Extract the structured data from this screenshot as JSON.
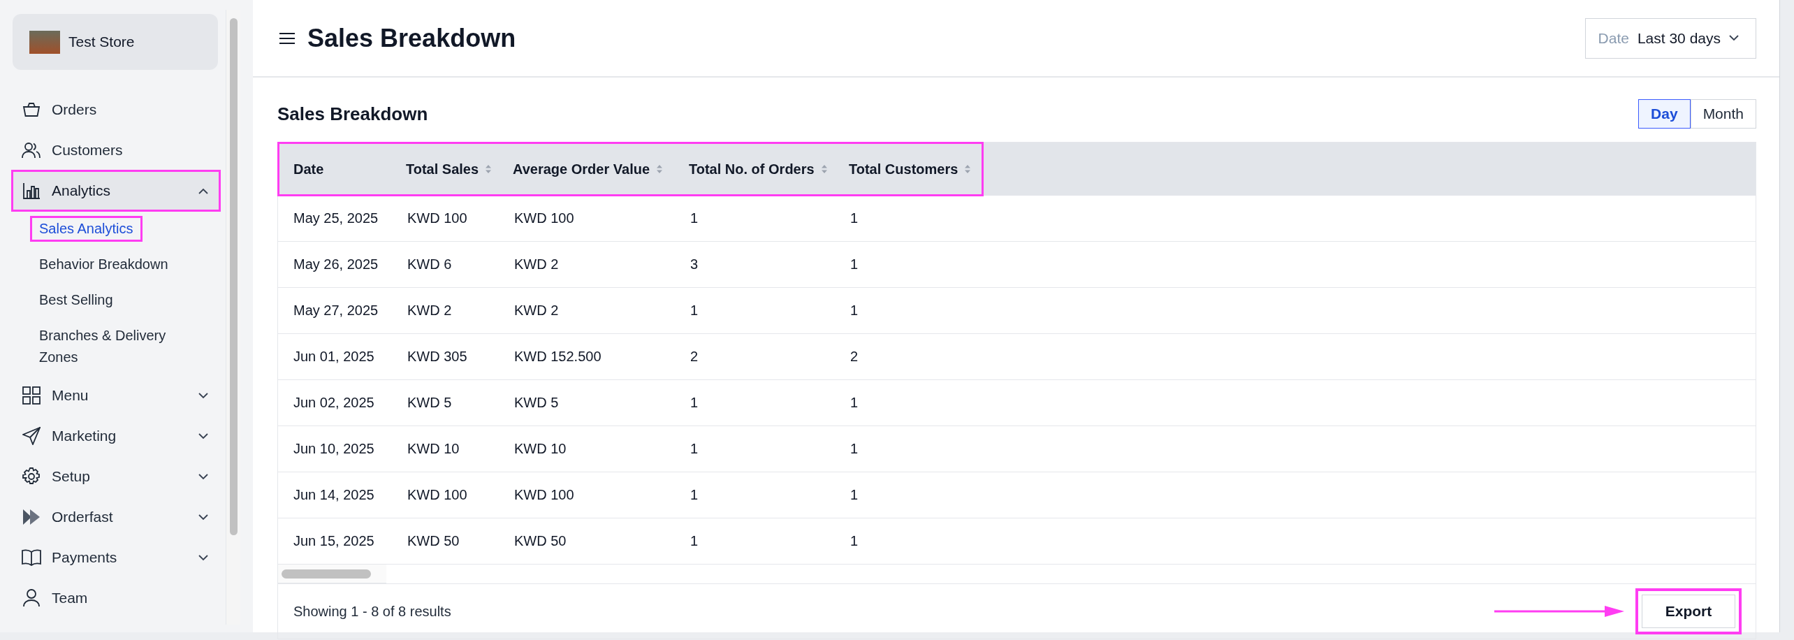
{
  "store": {
    "name": "Test Store"
  },
  "nav": [
    {
      "label": "Orders",
      "kind": "link",
      "selected": false
    },
    {
      "label": "Customers",
      "kind": "link",
      "selected": false
    },
    {
      "label": "Analytics",
      "kind": "group",
      "selected": true,
      "expanded": true,
      "highlighted": true,
      "children": [
        {
          "label": "Sales Analytics",
          "selected": true,
          "highlighted": true
        },
        {
          "label": "Behavior Breakdown",
          "selected": false,
          "highlighted": false
        },
        {
          "label": "Best Selling",
          "selected": false,
          "highlighted": false
        },
        {
          "label": "Branches & Delivery Zones",
          "selected": false,
          "highlighted": false
        }
      ]
    },
    {
      "label": "Menu",
      "kind": "group",
      "selected": false,
      "expanded": false,
      "highlighted": false
    },
    {
      "label": "Marketing",
      "kind": "group",
      "selected": false,
      "expanded": false,
      "highlighted": false
    },
    {
      "label": "Setup",
      "kind": "group",
      "selected": false,
      "expanded": false,
      "highlighted": false
    },
    {
      "label": "Orderfast",
      "kind": "group",
      "selected": false,
      "expanded": false,
      "highlighted": false
    },
    {
      "label": "Payments",
      "kind": "group",
      "selected": false,
      "expanded": false,
      "highlighted": false
    },
    {
      "label": "Team",
      "kind": "link",
      "selected": false
    }
  ],
  "header": {
    "title": "Sales Breakdown",
    "date_filter": {
      "label": "Date",
      "value": "Last 30 days"
    }
  },
  "section": {
    "title": "Sales Breakdown",
    "toggle": [
      {
        "label": "Day",
        "selected": true
      },
      {
        "label": "Month",
        "selected": false
      }
    ]
  },
  "table": {
    "header_highlighted": true,
    "columns": [
      {
        "label": "Date",
        "sortable": false
      },
      {
        "label": "Total Sales",
        "sortable": true
      },
      {
        "label": "Average Order Value",
        "sortable": true
      },
      {
        "label": "Total No. of Orders",
        "sortable": true
      },
      {
        "label": "Total Customers",
        "sortable": true
      }
    ],
    "rows": [
      [
        "May 25, 2025",
        "KWD 100",
        "KWD 100",
        "1",
        "1"
      ],
      [
        "May 26, 2025",
        "KWD 6",
        "KWD 2",
        "3",
        "1"
      ],
      [
        "May 27, 2025",
        "KWD 2",
        "KWD 2",
        "1",
        "1"
      ],
      [
        "Jun 01, 2025",
        "KWD 305",
        "KWD 152.500",
        "2",
        "2"
      ],
      [
        "Jun 02, 2025",
        "KWD 5",
        "KWD 5",
        "1",
        "1"
      ],
      [
        "Jun 10, 2025",
        "KWD 10",
        "KWD 10",
        "1",
        "1"
      ],
      [
        "Jun 14, 2025",
        "KWD 100",
        "KWD 100",
        "1",
        "1"
      ],
      [
        "Jun 15, 2025",
        "KWD 50",
        "KWD 50",
        "1",
        "1"
      ]
    ]
  },
  "footer": {
    "summary": "Showing 1 - 8 of 8 results",
    "export": {
      "label": "Export",
      "highlighted": true,
      "pointer_arrow": true
    }
  }
}
